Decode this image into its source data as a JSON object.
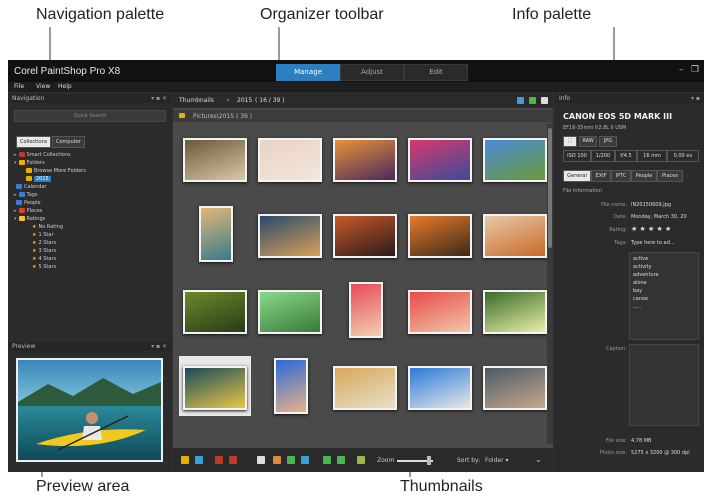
{
  "callouts": {
    "navigation": "Navigation palette",
    "organizer": "Organizer toolbar",
    "info": "Info palette",
    "preview": "Preview area",
    "thumbnails": "Thumbnails"
  },
  "app": {
    "title": "Corel PaintShop Pro X8",
    "tabs": [
      "Manage",
      "Adjust",
      "Edit"
    ],
    "active_tab": "Manage",
    "minimize_glyph": "–",
    "maximize_glyph": "❐",
    "menu": [
      "File",
      "View",
      "Help"
    ]
  },
  "navigation": {
    "title": "Navigation",
    "controls": "▾ ▪ ✕",
    "search_placeholder": "Quick Search",
    "tabs": [
      "Collections",
      "Computer"
    ],
    "tree": [
      {
        "label": "Smart Collections",
        "icon_color": "#c0392b",
        "expander": "▸"
      },
      {
        "label": "Folders",
        "icon_color": "#e8b100",
        "expander": "▾"
      },
      {
        "label": "Browse More Folders",
        "icon_color": "#e8b100",
        "expander": ""
      },
      {
        "label": "2015",
        "icon_color": "#e8b100",
        "expander": "",
        "selected": true
      },
      {
        "label": "Calendar",
        "icon_color": "#3a7bd5",
        "expander": ""
      },
      {
        "label": "Tags",
        "icon_color": "#3a7bd5",
        "expander": "▸"
      },
      {
        "label": "People",
        "icon_color": "#3a7bd5",
        "expander": ""
      },
      {
        "label": "Places",
        "icon_color": "#e03c31",
        "expander": "▸"
      },
      {
        "label": "Ratings",
        "icon_color": "#f1c232",
        "expander": "▾"
      }
    ],
    "ratings": [
      "No Rating",
      "1 Star",
      "2 Stars",
      "3 Stars",
      "4 Stars",
      "5 Stars"
    ]
  },
  "preview": {
    "title": "Preview",
    "controls": "▾ ▪ ✕"
  },
  "organizer": {
    "label": "Thumbnails",
    "separator": "›",
    "folder": "2015",
    "count": "( 16 / 39 )",
    "path": "Pictures\\2015 ( 39 )"
  },
  "bottom_bar": {
    "zoom_label": "Zoom",
    "sort_label": "Sort by:",
    "sort_value": "Folder ▾"
  },
  "thumbnails": [
    {
      "colors": [
        "#6b5a3a",
        "#d9c8a5"
      ],
      "orientation": "landscape"
    },
    {
      "colors": [
        "#e8d3c4",
        "#f3e6dc"
      ],
      "orientation": "landscape"
    },
    {
      "colors": [
        "#e8913a",
        "#4a2a5a"
      ],
      "orientation": "landscape"
    },
    {
      "colors": [
        "#d8386c",
        "#3a4c9a"
      ],
      "orientation": "landscape"
    },
    {
      "colors": [
        "#4a8ad8",
        "#6a9a3a"
      ],
      "orientation": "landscape"
    },
    {
      "colors": [
        "#e0b87a",
        "#3a7a8a"
      ],
      "orientation": "portrait"
    },
    {
      "colors": [
        "#2a4a6a",
        "#d8a05a"
      ],
      "orientation": "landscape"
    },
    {
      "colors": [
        "#c85a2a",
        "#2a1a1a"
      ],
      "orientation": "landscape"
    },
    {
      "colors": [
        "#e87a2a",
        "#3a2a1a"
      ],
      "orientation": "landscape"
    },
    {
      "colors": [
        "#e8c8a8",
        "#c86a2a"
      ],
      "orientation": "landscape"
    },
    {
      "colors": [
        "#6a8a2a",
        "#2a3a1a"
      ],
      "orientation": "landscape"
    },
    {
      "colors": [
        "#8ad88a",
        "#3a7a3a"
      ],
      "orientation": "landscape"
    },
    {
      "colors": [
        "#e84a5a",
        "#f0d0b0"
      ],
      "orientation": "portrait"
    },
    {
      "colors": [
        "#e84a4a",
        "#f0c8a8"
      ],
      "orientation": "landscape"
    },
    {
      "colors": [
        "#3a6a2a",
        "#e8f0a8"
      ],
      "orientation": "landscape"
    },
    {
      "colors": [
        "#1a4a5a",
        "#e8c84a"
      ],
      "orientation": "landscape",
      "selected": true
    },
    {
      "colors": [
        "#2a6ad8",
        "#e8b08a"
      ],
      "orientation": "portrait"
    },
    {
      "colors": [
        "#d8a85a",
        "#e8e0c8"
      ],
      "orientation": "landscape"
    },
    {
      "colors": [
        "#2a7ad8",
        "#e8e8e8"
      ],
      "orientation": "landscape"
    },
    {
      "colors": [
        "#4a5a6a",
        "#c8a88a"
      ],
      "orientation": "landscape"
    }
  ],
  "info": {
    "title": "Info",
    "camera": "CANON EOS 5D MARK III",
    "lens": "EF16-35mm f/2.8L II USM",
    "formats": [
      "⬚",
      "RAW",
      "JPG"
    ],
    "exif": [
      "ISO 100",
      "1/200",
      "f/4.5",
      "16 mm",
      "0.00 ev"
    ],
    "tabs": [
      "General",
      "EXIF",
      "IPTC",
      "People",
      "Places"
    ],
    "section": "File Information",
    "fields": [
      {
        "label": "File name:",
        "value": "IN20150609.jpg"
      },
      {
        "label": "Date:",
        "value": "Monday, March 30, 20"
      },
      {
        "label": "Rating:",
        "value": "★ ★ ★ ★ ★"
      },
      {
        "label": "Tags:",
        "value": "Type here to ad..."
      }
    ],
    "tags": [
      "active",
      "activity",
      "adventure",
      "alone",
      "bay",
      "canoe",
      "....."
    ],
    "caption_label": "Caption:",
    "file_size_label": "File size:",
    "file_size": "4.78 MB",
    "photo_size_label": "Photo size:",
    "photo_size": "5275 x 3200 @ 300 dpi"
  },
  "colors": {
    "accent": "#2c7fc0",
    "chrome": "#2b2b2b",
    "content": "#4a4a4a",
    "leader": "#9a9a9a"
  }
}
